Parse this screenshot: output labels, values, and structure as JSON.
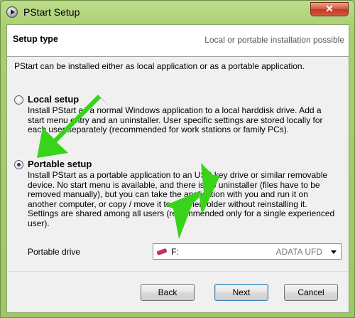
{
  "window": {
    "title": "PStart Setup",
    "close_label": "✕"
  },
  "header": {
    "title": "Setup type",
    "subtitle": "Local or portable installation possible"
  },
  "intro": "PStart can be installed either as local application or as a portable application.",
  "local": {
    "title": "Local setup",
    "desc": [
      "Install PStart as a normal Windows application to a local harddisk drive. Add a",
      "start menu entry and an uninstaller. User specific settings are stored locally for",
      "each user separately (recommended for work stations or family PCs)."
    ],
    "checked": false
  },
  "portable": {
    "title": "Portable setup",
    "desc": [
      "Install PStart as a portable application to an USB key drive or similar removable",
      "device. No start menu is available, and there is no uninstaller (files have to be",
      "removed manually), but you can take the application with you and run it on",
      "another computer, or copy / move it to another folder without reinstalling it.",
      "Settings are shared among all users (recommended only for a single experienced",
      "user)."
    ],
    "checked": true
  },
  "drive": {
    "label": "Portable drive",
    "letter": "F:",
    "name": "ADATA UFD",
    "icon": "usb-drive-icon"
  },
  "buttons": {
    "back": "Back",
    "next": "Next",
    "cancel": "Cancel"
  },
  "colors": {
    "arrow": "#3ad31b",
    "titlebar": "#a8cf72",
    "close": "#c2381f"
  }
}
